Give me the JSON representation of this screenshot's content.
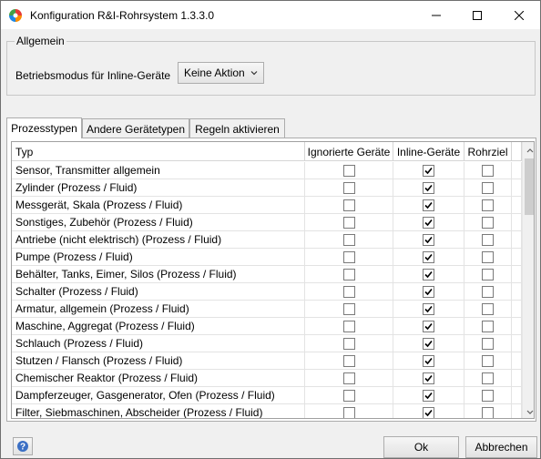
{
  "window": {
    "title": "Konfiguration R&I-Rohrsystem  1.3.3.0",
    "icon": "app-logo-icon"
  },
  "general": {
    "group_label": "Allgemein",
    "mode_label": "Betriebsmodus für Inline-Geräte",
    "mode_value": "Keine Aktion"
  },
  "tabs": [
    {
      "label": "Prozesstypen",
      "active": true
    },
    {
      "label": "Andere Gerätetypen",
      "active": false
    },
    {
      "label": "Regeln aktivieren",
      "active": false
    }
  ],
  "table": {
    "headers": {
      "typ": "Typ",
      "ignored": "Ignorierte Geräte",
      "inline": "Inline-Geräte",
      "target": "Rohrziel"
    },
    "rows": [
      {
        "typ": "Sensor, Transmitter allgemein",
        "ignored": false,
        "inline": true,
        "target": false
      },
      {
        "typ": "Zylinder (Prozess / Fluid)",
        "ignored": false,
        "inline": true,
        "target": false
      },
      {
        "typ": "Messgerät, Skala (Prozess / Fluid)",
        "ignored": false,
        "inline": true,
        "target": false
      },
      {
        "typ": "Sonstiges, Zubehör (Prozess / Fluid)",
        "ignored": false,
        "inline": true,
        "target": false
      },
      {
        "typ": "Antriebe (nicht elektrisch) (Prozess / Fluid)",
        "ignored": false,
        "inline": true,
        "target": false
      },
      {
        "typ": "Pumpe (Prozess / Fluid)",
        "ignored": false,
        "inline": true,
        "target": false
      },
      {
        "typ": "Behälter, Tanks, Eimer, Silos (Prozess / Fluid)",
        "ignored": false,
        "inline": true,
        "target": false
      },
      {
        "typ": "Schalter (Prozess / Fluid)",
        "ignored": false,
        "inline": true,
        "target": false
      },
      {
        "typ": "Armatur, allgemein (Prozess / Fluid)",
        "ignored": false,
        "inline": true,
        "target": false
      },
      {
        "typ": "Maschine, Aggregat (Prozess / Fluid)",
        "ignored": false,
        "inline": true,
        "target": false
      },
      {
        "typ": "Schlauch (Prozess / Fluid)",
        "ignored": false,
        "inline": true,
        "target": false
      },
      {
        "typ": "Stutzen / Flansch (Prozess / Fluid)",
        "ignored": false,
        "inline": true,
        "target": false
      },
      {
        "typ": "Chemischer Reaktor (Prozess / Fluid)",
        "ignored": false,
        "inline": true,
        "target": false
      },
      {
        "typ": "Dampferzeuger, Gasgenerator, Ofen (Prozess / Fluid)",
        "ignored": false,
        "inline": true,
        "target": false
      },
      {
        "typ": "Filter, Siebmaschinen, Abscheider (Prozess / Fluid)",
        "ignored": false,
        "inline": true,
        "target": false
      }
    ]
  },
  "footer": {
    "help_icon": "help-icon",
    "ok_label": "Ok",
    "cancel_label": "Abbrechen"
  }
}
